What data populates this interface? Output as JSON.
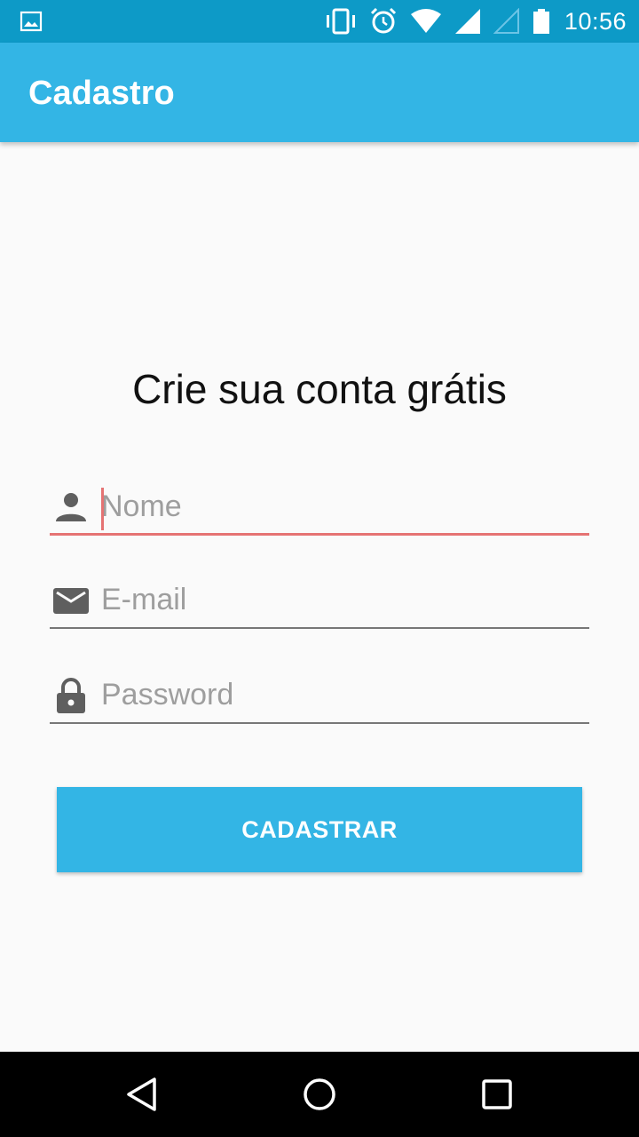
{
  "status_bar": {
    "time": "10:56",
    "icons": [
      "image-notification-icon",
      "vibrate-icon",
      "alarm-icon",
      "wifi-icon",
      "signal-icon",
      "signal-empty-icon",
      "battery-icon"
    ]
  },
  "app_bar": {
    "title": "Cadastro",
    "color": "#33b5e5"
  },
  "form": {
    "heading": "Crie sua conta grátis",
    "name_placeholder": "Nome",
    "email_placeholder": "E-mail",
    "password_placeholder": "Password",
    "submit_label": "CADASTRAR",
    "focus_color": "#e57373"
  },
  "nav_bar": {
    "buttons": [
      "back-icon",
      "home-icon",
      "recents-icon"
    ]
  }
}
